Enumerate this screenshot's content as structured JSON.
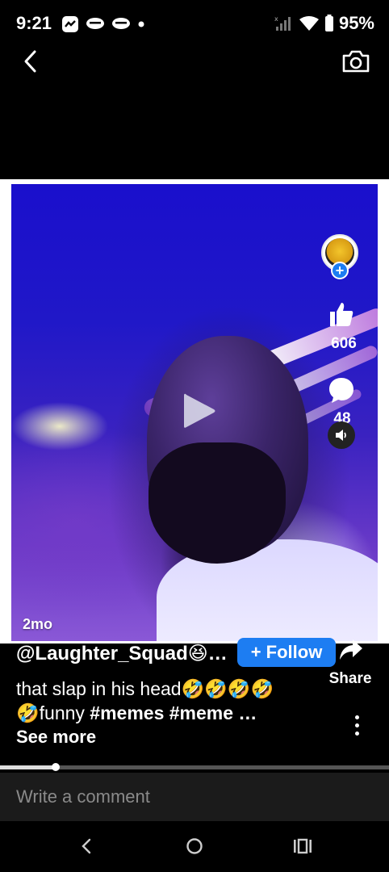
{
  "status_bar": {
    "time": "9:21",
    "battery": "95%"
  },
  "video": {
    "age": "2mo"
  },
  "actions": {
    "likes": "606",
    "comments": "48"
  },
  "post": {
    "username": "@Laughter_Squad😆…",
    "follow_label": "+ Follow",
    "share_label": "Share",
    "caption_line1": "that slap in his head🤣🤣🤣🤣",
    "caption_line2_prefix": "🤣funny ",
    "caption_tags": "#memes #meme …",
    "see_more": "See more"
  },
  "playback": {
    "progress": 0.145
  },
  "comment_box": {
    "placeholder": "Write a comment"
  },
  "colors": {
    "accent": "#1d7df2",
    "background": "#000000"
  }
}
